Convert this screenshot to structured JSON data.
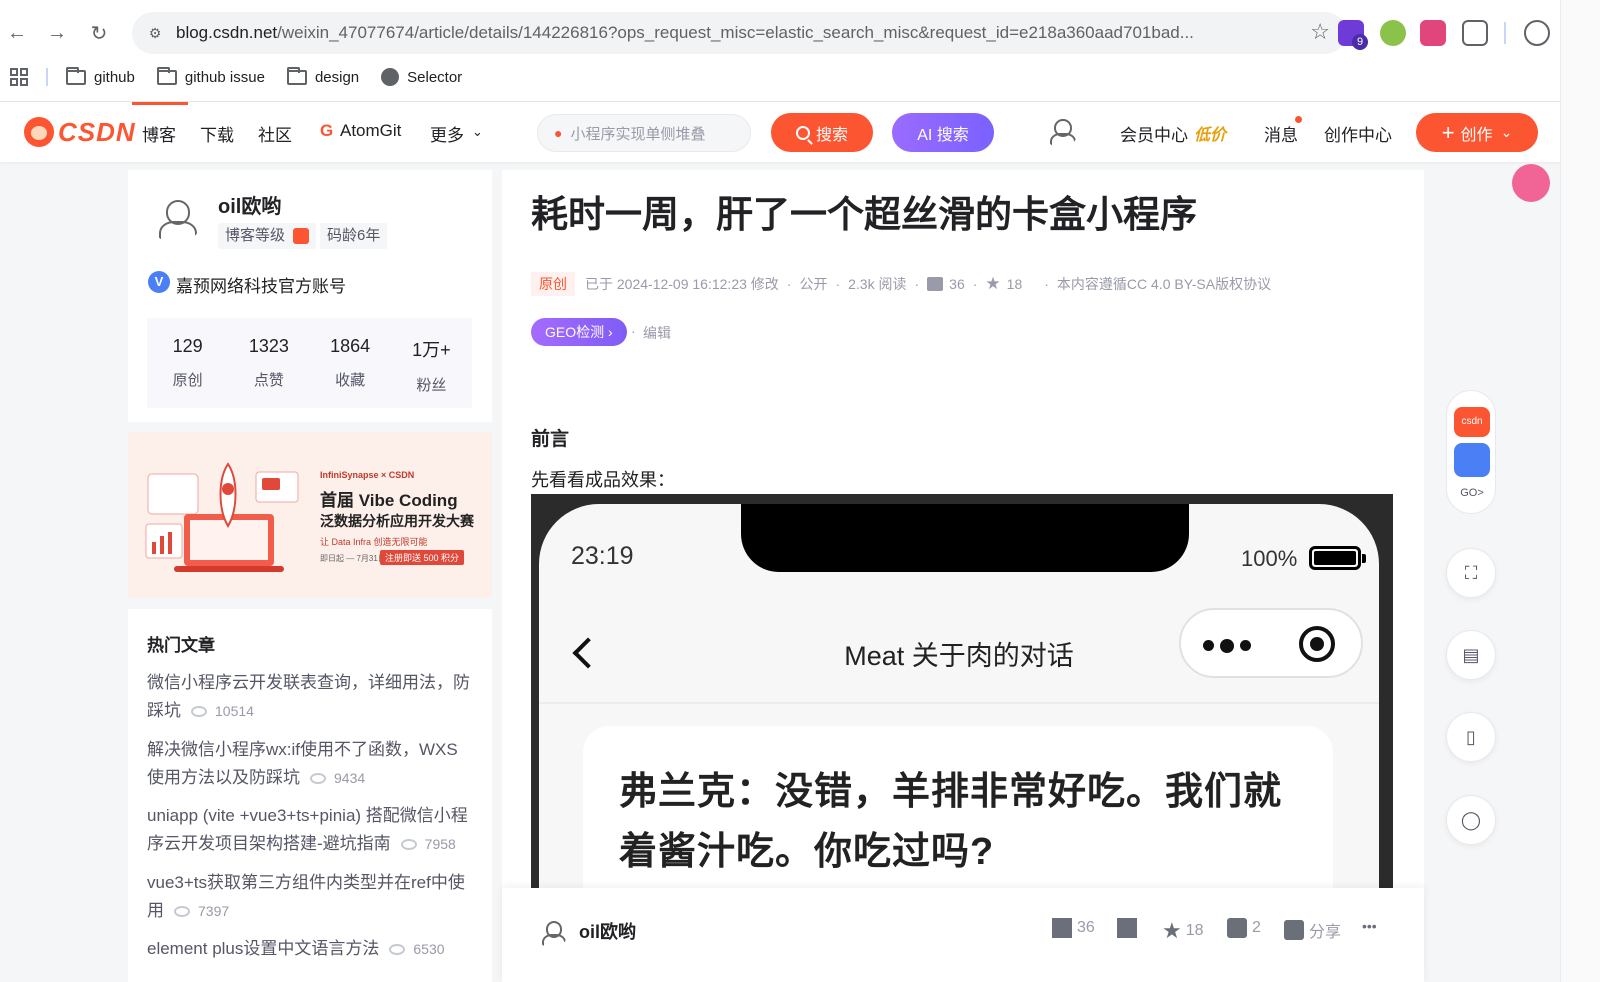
{
  "browser": {
    "url_host": "blog.csdn.net",
    "url_rest": "/weixin_47077674/article/details/144226816?ops_request_misc=elastic_search_misc&request_id=e218a360aad701bad...",
    "ext_badge": "9",
    "bookmarks": [
      "github",
      "github issue",
      "design",
      "Selector"
    ]
  },
  "csdn": {
    "logo": "CSDN",
    "nav": [
      "博客",
      "下载",
      "社区",
      "AtomGit",
      "更多"
    ],
    "search_placeholder": "小程序实现单侧堆叠",
    "search_label": "搜索",
    "ai_label": "AI 搜索",
    "member": "会员中心",
    "member_tag": "低价",
    "messages": "消息",
    "creator": "创作中心",
    "create": "创作"
  },
  "profile": {
    "name": "oil欧哟",
    "level_label": "博客等级",
    "code_age": "码龄6年",
    "verified": "嘉预网络科技官方账号",
    "stats": [
      {
        "num": "129",
        "label": "原创"
      },
      {
        "num": "1323",
        "label": "点赞"
      },
      {
        "num": "1864",
        "label": "收藏"
      },
      {
        "num": "1万+",
        "label": "粉丝"
      }
    ]
  },
  "ad": {
    "brand": "InfiniSynapse × CSDN",
    "line1": "首届 Vibe Coding",
    "line2": "泛数据分析应用开发大赛",
    "line3": "让 Data Infra 创造无限可能",
    "dates": "即日起 — 7月31日",
    "cta": "注册即送 500 积分"
  },
  "hot": {
    "heading": "热门文章",
    "items": [
      {
        "line1": "微信小程序云开发联表查询，详细用法，防",
        "line2": "踩坑",
        "views": "10514"
      },
      {
        "line1": "解决微信小程序wx:if使用不了函数，WXS",
        "line2": "使用方法以及防踩坑",
        "views": "9434"
      },
      {
        "line1": "uniapp (vite +vue3+ts+pinia) 搭配微信小程",
        "line2": "序云开发项目架构搭建-避坑指南",
        "views": "7958"
      },
      {
        "line1": "vue3+ts获取第三方组件内类型并在ref中使",
        "line2": "用",
        "views": "7397"
      },
      {
        "line1": "element plus设置中文语言方法",
        "line2": "",
        "views": "6530"
      }
    ]
  },
  "article": {
    "title": "耗时一周，肝了一个超丝滑的卡盒小程序",
    "original": "原创",
    "modified": "已于 2024-12-09 16:12:23 修改",
    "public": "公开",
    "reads": "2.3k 阅读",
    "likes": "36",
    "favorites": "18",
    "license": "本内容遵循CC 4.0 BY-SA版权协议",
    "geo": "GEO检测",
    "edit": "编辑",
    "h_preface": "前言",
    "p_preface": "先看看成品效果：",
    "phone": {
      "time": "23:19",
      "battery": "100%",
      "battery_level": 1.0,
      "title": "Meat 关于肉的对话",
      "bubble": "弗兰克：没错，羊排非常好吃。我们就着酱汁吃。你吃过吗?"
    }
  },
  "toolbar": {
    "author": "oil欧哟",
    "likes": "36",
    "favorites": "18",
    "comments": "2",
    "share": "分享",
    "more": "•••"
  },
  "side_tools": {
    "go": "GO>"
  }
}
